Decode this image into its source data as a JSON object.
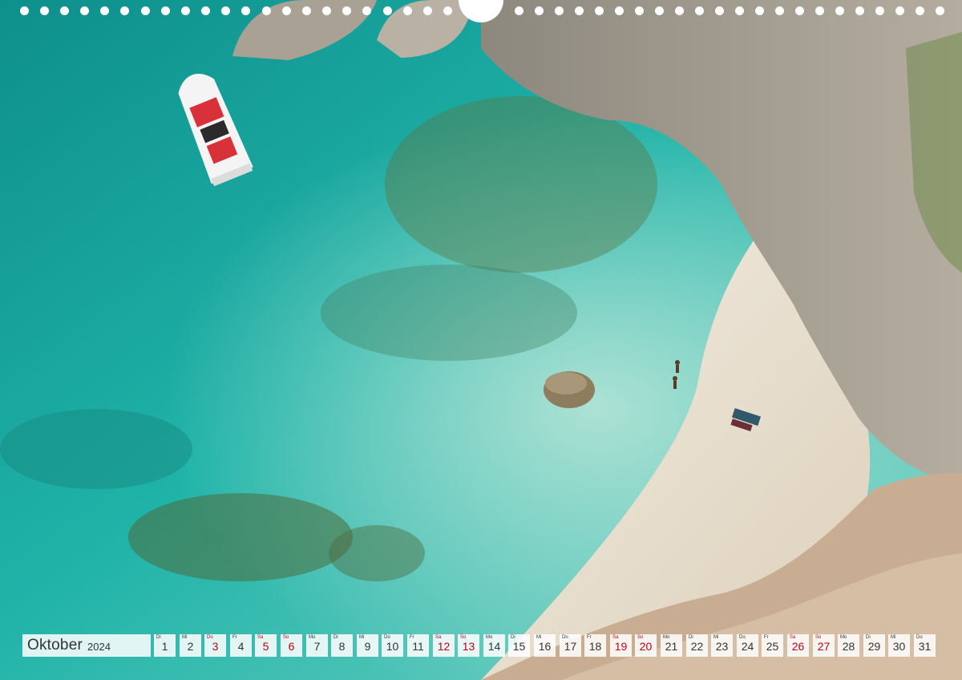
{
  "calendar": {
    "month": "Oktober",
    "year": "2024",
    "weekend_color": "#c0001a",
    "text_color": "#333333",
    "days": [
      {
        "wd": "Di",
        "d": "1",
        "we": false
      },
      {
        "wd": "Mi",
        "d": "2",
        "we": false
      },
      {
        "wd": "Do",
        "d": "3",
        "we": true
      },
      {
        "wd": "Fr",
        "d": "4",
        "we": false
      },
      {
        "wd": "Sa",
        "d": "5",
        "we": true
      },
      {
        "wd": "So",
        "d": "6",
        "we": true
      },
      {
        "wd": "Mo",
        "d": "7",
        "we": false
      },
      {
        "wd": "Di",
        "d": "8",
        "we": false
      },
      {
        "wd": "Mi",
        "d": "9",
        "we": false
      },
      {
        "wd": "Do",
        "d": "10",
        "we": false
      },
      {
        "wd": "Fr",
        "d": "11",
        "we": false
      },
      {
        "wd": "Sa",
        "d": "12",
        "we": true
      },
      {
        "wd": "So",
        "d": "13",
        "we": true
      },
      {
        "wd": "Mo",
        "d": "14",
        "we": false
      },
      {
        "wd": "Di",
        "d": "15",
        "we": false
      },
      {
        "wd": "Mi",
        "d": "16",
        "we": false
      },
      {
        "wd": "Do",
        "d": "17",
        "we": false
      },
      {
        "wd": "Fr",
        "d": "18",
        "we": false
      },
      {
        "wd": "Sa",
        "d": "19",
        "we": true
      },
      {
        "wd": "So",
        "d": "20",
        "we": true
      },
      {
        "wd": "Mo",
        "d": "21",
        "we": false
      },
      {
        "wd": "Di",
        "d": "22",
        "we": false
      },
      {
        "wd": "Mi",
        "d": "23",
        "we": false
      },
      {
        "wd": "Do",
        "d": "24",
        "we": false
      },
      {
        "wd": "Fr",
        "d": "25",
        "we": false
      },
      {
        "wd": "Sa",
        "d": "26",
        "we": true
      },
      {
        "wd": "So",
        "d": "27",
        "we": true
      },
      {
        "wd": "Mo",
        "d": "28",
        "we": false
      },
      {
        "wd": "Di",
        "d": "29",
        "we": false
      },
      {
        "wd": "Mi",
        "d": "30",
        "we": false
      },
      {
        "wd": "Do",
        "d": "31",
        "we": false
      }
    ]
  },
  "photo": {
    "water_color": "#1fa9a3",
    "shallow_color": "#7fd3c6",
    "sand_color": "#e9dfcf",
    "cliff_color": "#a8a296"
  }
}
